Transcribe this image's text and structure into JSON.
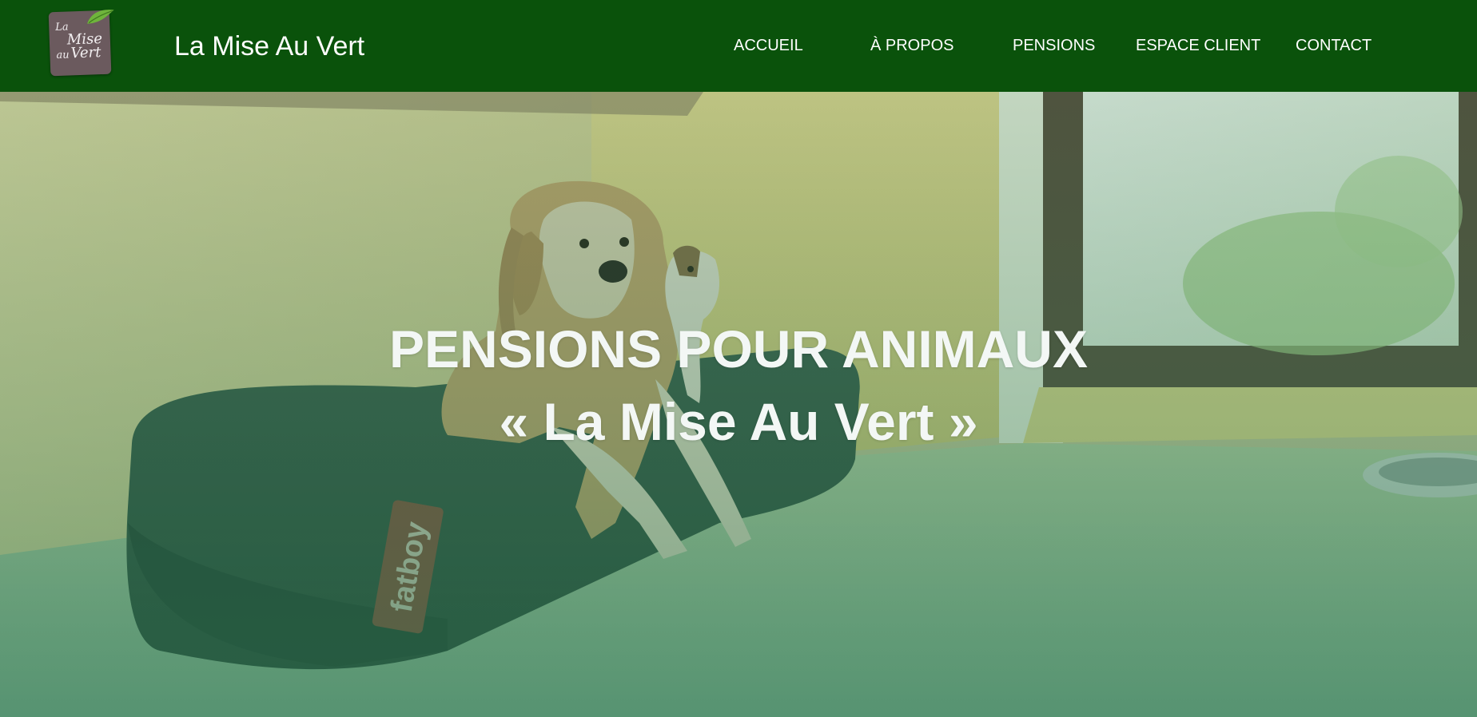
{
  "header": {
    "logo": {
      "line1": "La",
      "line2": "Mise",
      "line3a": "au",
      "line3b": "Vert"
    },
    "site_title": "La Mise Au Vert",
    "nav": [
      {
        "label": "ACCUEIL",
        "name": "nav-accueil"
      },
      {
        "label": "À PROPOS",
        "name": "nav-a-propos"
      },
      {
        "label": "PENSIONS",
        "name": "nav-pensions"
      },
      {
        "label": "ESPACE CLIENT",
        "name": "nav-espace-client"
      },
      {
        "label": "CONTACT",
        "name": "nav-contact"
      }
    ]
  },
  "hero": {
    "title_line1": "PENSIONS POUR ANIMAUX",
    "title_line2": "« La Mise Au Vert »",
    "cushion_brand": "fatboy"
  },
  "colors": {
    "header_bg": "#0a520b",
    "logo_bg": "#6b5a5e",
    "overlay_green": "#287850",
    "text_white": "#ffffff"
  }
}
